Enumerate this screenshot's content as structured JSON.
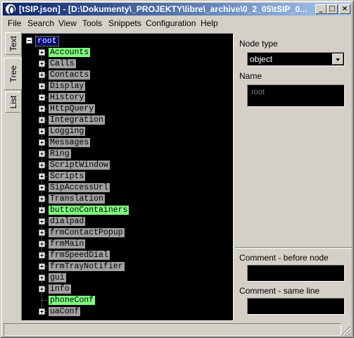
{
  "window": {
    "title": "[tSIP.json] - [D:\\Dokumenty\\_PROJEKTY\\libre\\_archive\\0_2_05\\tSIP_0...",
    "buttons": {
      "minimize": "_",
      "maximize": "□",
      "close": "×"
    }
  },
  "menu": [
    {
      "label": "File"
    },
    {
      "label": "Search"
    },
    {
      "label": "View"
    },
    {
      "label": "Tools"
    },
    {
      "label": "Snippets"
    },
    {
      "label": "Configuration"
    },
    {
      "label": "Help"
    }
  ],
  "tabs": [
    {
      "label": "Text",
      "active": false
    },
    {
      "label": "Tree",
      "active": true
    },
    {
      "label": "List",
      "active": false
    }
  ],
  "tree": {
    "root": "root",
    "nodes": [
      {
        "label": "Accounts",
        "color": "green",
        "expandable": true
      },
      {
        "label": "Calls",
        "color": "gray",
        "expandable": true
      },
      {
        "label": "Contacts",
        "color": "gray",
        "expandable": true
      },
      {
        "label": "Display",
        "color": "gray",
        "expandable": true
      },
      {
        "label": "History",
        "color": "gray",
        "expandable": true
      },
      {
        "label": "HttpQuery",
        "color": "gray",
        "expandable": true
      },
      {
        "label": "Integration",
        "color": "gray",
        "expandable": true
      },
      {
        "label": "Logging",
        "color": "gray",
        "expandable": true
      },
      {
        "label": "Messages",
        "color": "gray",
        "expandable": true
      },
      {
        "label": "Ring",
        "color": "gray",
        "expandable": true
      },
      {
        "label": "ScriptWindow",
        "color": "gray",
        "expandable": true
      },
      {
        "label": "Scripts",
        "color": "gray",
        "expandable": true
      },
      {
        "label": "SipAccessUrl",
        "color": "gray",
        "expandable": true
      },
      {
        "label": "Translation",
        "color": "gray",
        "expandable": true
      },
      {
        "label": "buttonContainers",
        "color": "green",
        "expandable": true
      },
      {
        "label": "dialpad",
        "color": "gray",
        "expandable": true
      },
      {
        "label": "frmContactPopup",
        "color": "gray",
        "expandable": true
      },
      {
        "label": "frmMain",
        "color": "gray",
        "expandable": true
      },
      {
        "label": "frmSpeedDial",
        "color": "gray",
        "expandable": true
      },
      {
        "label": "frmTrayNotifier",
        "color": "gray",
        "expandable": true
      },
      {
        "label": "gui",
        "color": "gray",
        "expandable": true
      },
      {
        "label": "info",
        "color": "gray",
        "expandable": true
      },
      {
        "label": "phoneConf",
        "color": "green",
        "expandable": false
      },
      {
        "label": "uaConf",
        "color": "gray",
        "expandable": true
      }
    ]
  },
  "side": {
    "node_type_label": "Node type",
    "node_type_value": "object",
    "name_label": "Name",
    "name_value": "root",
    "comment_before_label": "Comment - before node",
    "comment_same_line_label": "Comment - same line"
  },
  "colors": {
    "green": "#80ff80",
    "gray": "#a0a0a0",
    "titlebar": "#0a246a"
  }
}
